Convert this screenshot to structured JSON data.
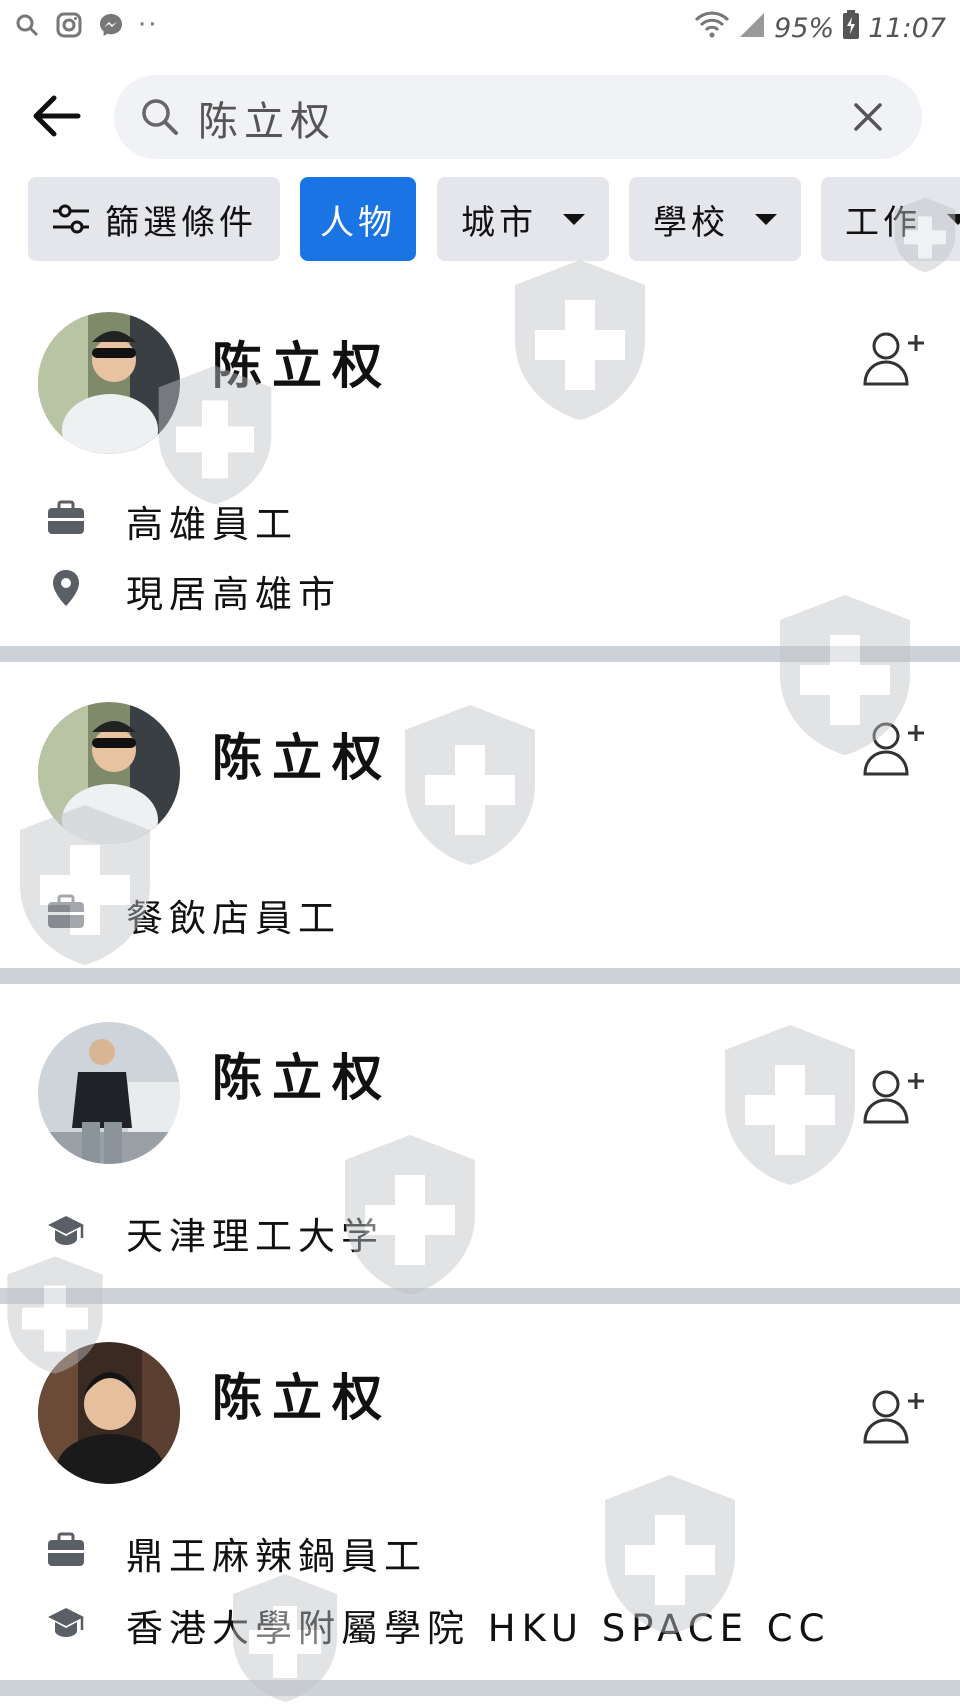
{
  "status_bar": {
    "battery": "95%",
    "time": "11:07",
    "icons": [
      "search-icon",
      "instagram-icon",
      "messenger-icon",
      "more-dots-icon",
      "wifi-icon",
      "signal-icon",
      "battery-charging-icon"
    ],
    "dots": "··"
  },
  "search": {
    "query": "陈立权",
    "icons": {
      "back": "back-arrow-icon",
      "search": "search-icon",
      "clear": "close-icon"
    }
  },
  "filters": {
    "filter_label": "篩選條件",
    "chips": [
      {
        "label": "人物",
        "active": true
      },
      {
        "label": "城市",
        "dropdown": true
      },
      {
        "label": "學校",
        "dropdown": true
      },
      {
        "label": "工作",
        "dropdown": true
      }
    ]
  },
  "results": [
    {
      "name": "陈立权",
      "details": [
        {
          "icon": "briefcase-icon",
          "text": "高雄員工"
        },
        {
          "icon": "location-pin-icon",
          "text": "現居高雄市"
        }
      ]
    },
    {
      "name": "陈立权",
      "details": [
        {
          "icon": "briefcase-icon",
          "text": "餐飲店員工"
        }
      ]
    },
    {
      "name": "陈立权",
      "details": [
        {
          "icon": "graduation-cap-icon",
          "text": "天津理工大学"
        }
      ]
    },
    {
      "name": "陈立权",
      "details": [
        {
          "icon": "briefcase-icon",
          "text": "鼎王麻辣鍋員工"
        },
        {
          "icon": "graduation-cap-icon",
          "text": "香港大學附屬學院 HKU SPACE CC"
        }
      ]
    }
  ],
  "colors": {
    "accent": "#1b74e4",
    "chip_bg": "#e4e6eb",
    "search_bg": "#f0f2f5",
    "divider": "#ced3da"
  }
}
